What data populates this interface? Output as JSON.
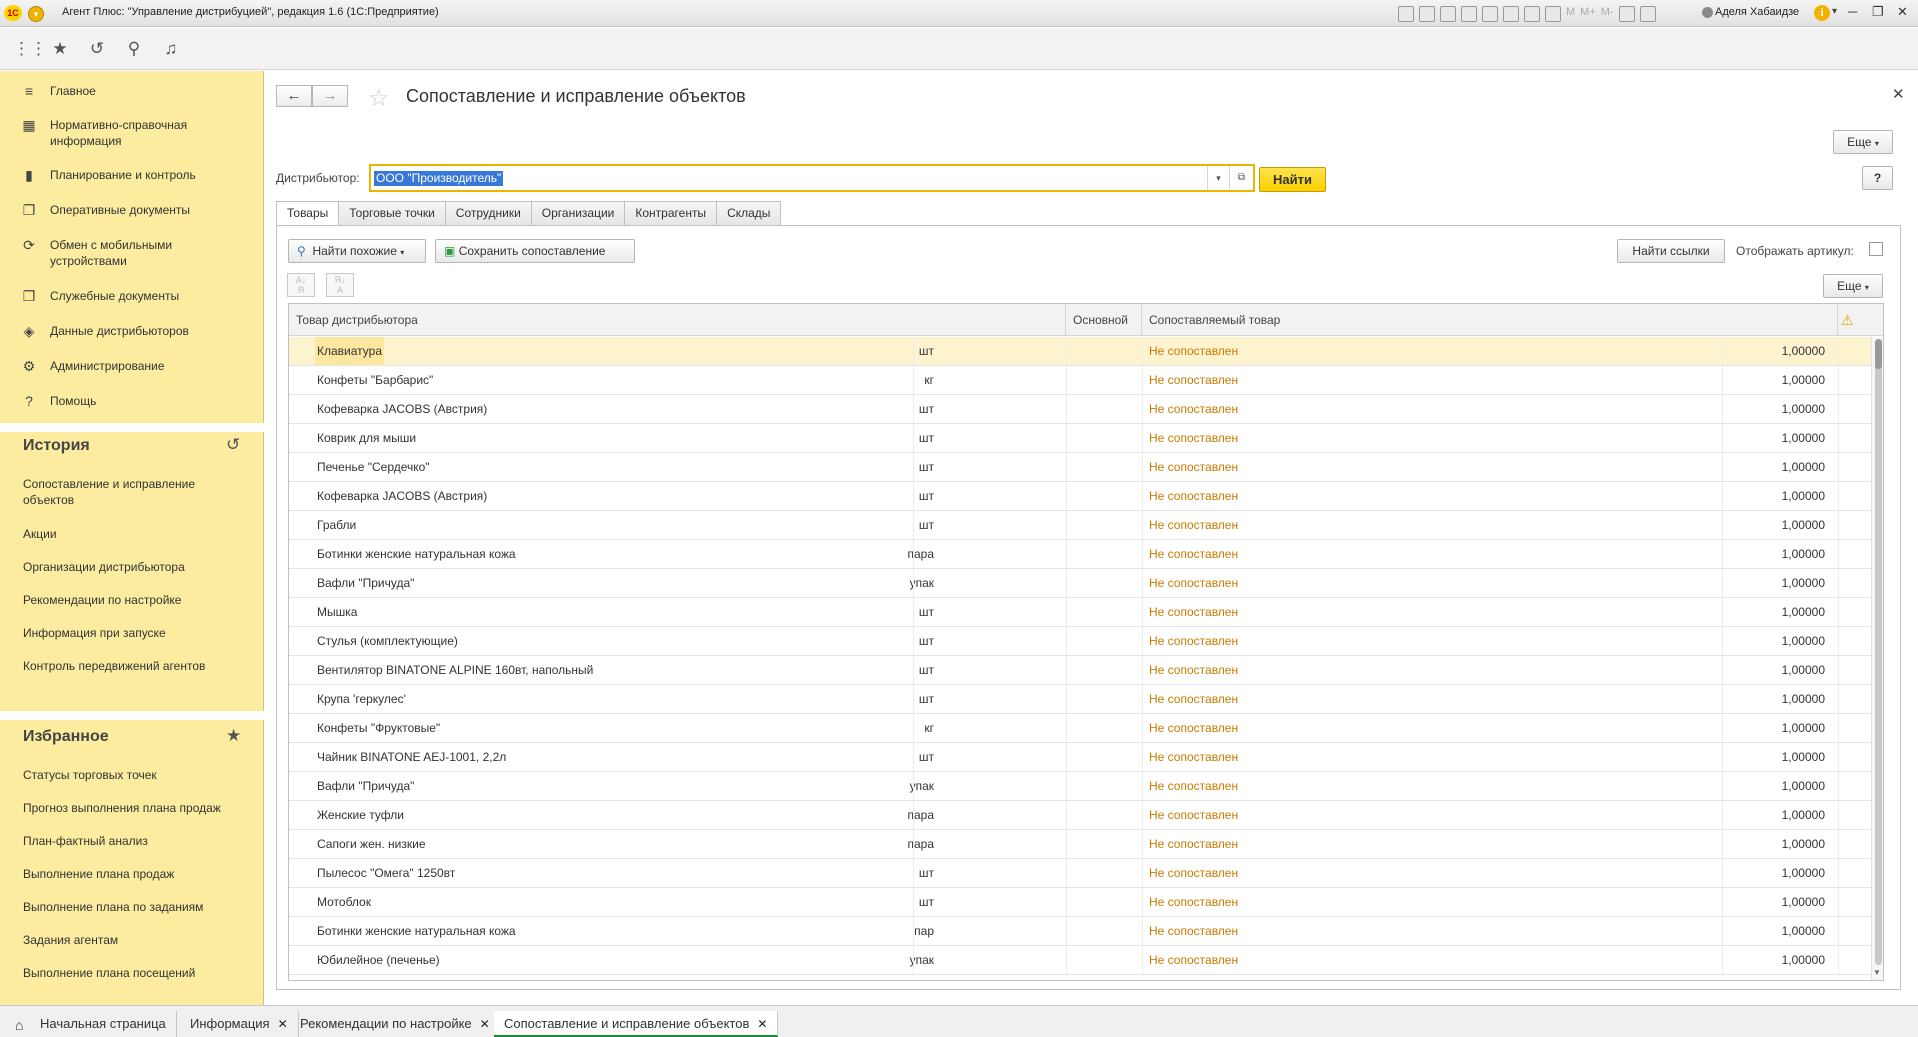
{
  "window": {
    "logo_text": "1С",
    "title": "Агент Плюс: \"Управление дистрибуцией\", редакция 1.6  (1С:Предприятие)",
    "user": "Аделя Хабаидзе",
    "memory_buttons": [
      "M",
      "M+",
      "M-"
    ],
    "controls": {
      "minimize": "─",
      "restore": "❐",
      "close": "✕"
    }
  },
  "toolbar": {
    "icons": [
      "apps-grid-icon",
      "star-icon",
      "history-icon",
      "search-icon",
      "bell-icon"
    ]
  },
  "sidebar": {
    "sections": [
      {
        "icon": "≡",
        "label": "Главное"
      },
      {
        "icon": "▦",
        "label": "Нормативно-справочная информация"
      },
      {
        "icon": "▮",
        "label": "Планирование и контроль"
      },
      {
        "icon": "❐",
        "label": "Оперативные документы"
      },
      {
        "icon": "⟳",
        "label": "Обмен с мобильными устройствами"
      },
      {
        "icon": "❐",
        "label": "Служебные документы"
      },
      {
        "icon": "◈",
        "label": "Данные дистрибьюторов"
      },
      {
        "icon": "⚙",
        "label": "Администрирование"
      },
      {
        "icon": "?",
        "label": "Помощь"
      }
    ],
    "history_title": "История",
    "history": [
      "Сопоставление и исправление объектов",
      "Акции",
      "Организации дистрибьютора",
      "Рекомендации по настройке",
      "Информация при запуске",
      "Контроль передвижений агентов"
    ],
    "favorites_title": "Избранное",
    "favorites": [
      "Статусы торговых точек",
      "Прогноз выполнения плана продаж",
      "План-фактный анализ",
      "Выполнение плана продаж",
      "Выполнение плана по заданиям",
      "Задания агентам",
      "Выполнение плана посещений"
    ]
  },
  "page": {
    "title": "Сопоставление и исправление объектов",
    "more_label": "Еще",
    "help_label": "?",
    "distributor_label": "Дистрибьютор:",
    "distributor_value": "ООО \"Производитель\"",
    "find_label": "Найти",
    "tabs": [
      "Товары",
      "Торговые точки",
      "Сотрудники",
      "Организации",
      "Контрагенты",
      "Склады"
    ],
    "find_similar_label": "Найти похожие",
    "save_mapping_label": "Сохранить сопоставление",
    "find_links_label": "Найти ссылки",
    "show_article_label": "Отображать артикул:",
    "grid_more_label": "Еще"
  },
  "grid": {
    "columns": [
      "Товар дистрибьютора",
      "Основной",
      "Сопоставляемый товар"
    ],
    "rows": [
      {
        "name": "Клавиатура",
        "unit": "шт",
        "mapped": "Не сопоставлен",
        "qty": "1,00000"
      },
      {
        "name": "Конфеты \"Барбарис\"",
        "unit": "кг",
        "mapped": "Не сопоставлен",
        "qty": "1,00000"
      },
      {
        "name": "Кофеварка JACOBS (Австрия)",
        "unit": "шт",
        "mapped": "Не сопоставлен",
        "qty": "1,00000"
      },
      {
        "name": "Коврик для мыши",
        "unit": "шт",
        "mapped": "Не сопоставлен",
        "qty": "1,00000"
      },
      {
        "name": "Печенье \"Сердечко\"",
        "unit": "шт",
        "mapped": "Не сопоставлен",
        "qty": "1,00000"
      },
      {
        "name": "Кофеварка JACOBS (Австрия)",
        "unit": "шт",
        "mapped": "Не сопоставлен",
        "qty": "1,00000"
      },
      {
        "name": "Грабли",
        "unit": "шт",
        "mapped": "Не сопоставлен",
        "qty": "1,00000"
      },
      {
        "name": "Ботинки женские натуральная кожа",
        "unit": "пара",
        "mapped": "Не сопоставлен",
        "qty": "1,00000"
      },
      {
        "name": "Вафли \"Причуда\"",
        "unit": "упак",
        "mapped": "Не сопоставлен",
        "qty": "1,00000"
      },
      {
        "name": "Мышка",
        "unit": "шт",
        "mapped": "Не сопоставлен",
        "qty": "1,00000"
      },
      {
        "name": "Стулья (комплектующие)",
        "unit": "шт",
        "mapped": "Не сопоставлен",
        "qty": "1,00000"
      },
      {
        "name": "Вентилятор BINATONE ALPINE 160вт, напольный",
        "unit": "шт",
        "mapped": "Не сопоставлен",
        "qty": "1,00000"
      },
      {
        "name": "Крупа 'геркулес'",
        "unit": "шт",
        "mapped": "Не сопоставлен",
        "qty": "1,00000"
      },
      {
        "name": "Конфеты \"Фруктовые\"",
        "unit": "кг",
        "mapped": "Не сопоставлен",
        "qty": "1,00000"
      },
      {
        "name": "Чайник BINATONE  AEJ-1001,  2,2л",
        "unit": "шт",
        "mapped": "Не сопоставлен",
        "qty": "1,00000"
      },
      {
        "name": "Вафли \"Причуда\"",
        "unit": "упак",
        "mapped": "Не сопоставлен",
        "qty": "1,00000"
      },
      {
        "name": "Женские туфли",
        "unit": "пара",
        "mapped": "Не сопоставлен",
        "qty": "1,00000"
      },
      {
        "name": "Сапоги жен. низкие",
        "unit": "пара",
        "mapped": "Не сопоставлен",
        "qty": "1,00000"
      },
      {
        "name": "Пылесос \"Омега\" 1250вт",
        "unit": "шт",
        "mapped": "Не сопоставлен",
        "qty": "1,00000"
      },
      {
        "name": "Мотоблок",
        "unit": "шт",
        "mapped": "Не сопоставлен",
        "qty": "1,00000"
      },
      {
        "name": "Ботинки женские натуральная кожа",
        "unit": "пар",
        "mapped": "Не сопоставлен",
        "qty": "1,00000"
      },
      {
        "name": "Юбилейное (печенье)",
        "unit": "упак",
        "mapped": "Не сопоставлен",
        "qty": "1,00000"
      }
    ]
  },
  "bottom_tabs": [
    {
      "label": "Начальная страница",
      "closable": false
    },
    {
      "label": "Информация",
      "closable": true
    },
    {
      "label": "Рекомендации по настройке",
      "closable": true
    },
    {
      "label": "Сопоставление и исправление объектов",
      "closable": true
    }
  ],
  "colors": {
    "sidebar_bg": "#fbeca0",
    "accent_yellow": "#fad000",
    "unmapped_text": "#c97a00",
    "active_tab_underline": "#1e8a3a"
  }
}
